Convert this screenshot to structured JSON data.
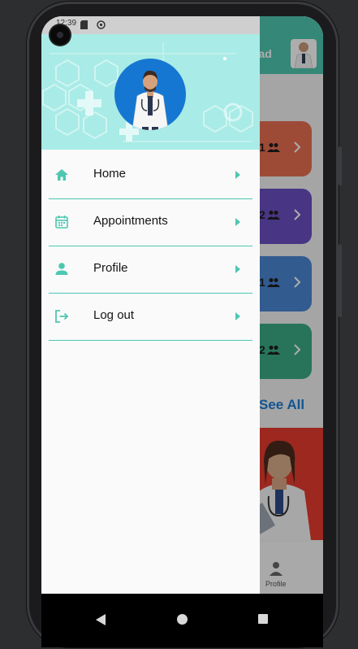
{
  "status_bar": {
    "time": "12:39"
  },
  "background_app": {
    "header_name_fragment": "mad",
    "cards": [
      {
        "count": "1",
        "color": "#e76f51"
      },
      {
        "count": "2",
        "color": "#6a4fc2"
      },
      {
        "count": "1",
        "color": "#4a86d4"
      },
      {
        "count": "2",
        "color": "#3aab85"
      }
    ],
    "see_all_label": "See All",
    "bottom_nav_label": "Profile"
  },
  "drawer": {
    "menu": [
      {
        "label": "Home",
        "icon": "home-icon"
      },
      {
        "label": "Appointments",
        "icon": "calendar-icon"
      },
      {
        "label": "Profile",
        "icon": "person-icon"
      },
      {
        "label": "Log out",
        "icon": "logout-icon"
      }
    ]
  },
  "colors": {
    "accent": "#4ec7b0",
    "drawer_header": "#a9ebe6",
    "avatar_circle": "#1577d1",
    "see_all": "#1b7cd8"
  },
  "system_nav": {
    "buttons": [
      "back-icon",
      "home-circle-icon",
      "recents-icon"
    ]
  }
}
